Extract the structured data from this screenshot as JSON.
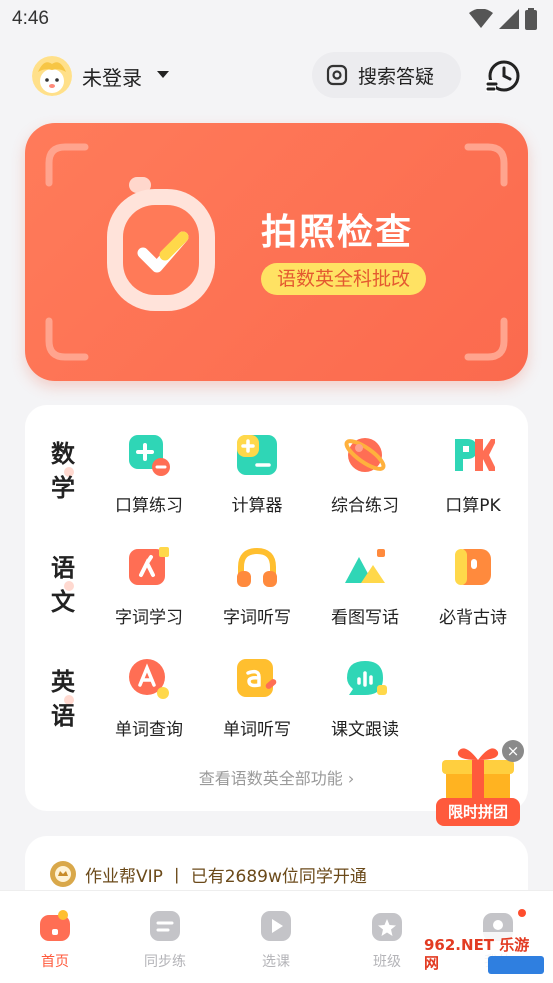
{
  "status_bar": {
    "time": "4:46"
  },
  "header": {
    "user_name": "未登录",
    "search_label": "搜索答疑"
  },
  "hero": {
    "title": "拍照检查",
    "subtitle": "语数英全科批改"
  },
  "subjects": [
    {
      "name": "数学",
      "tools": [
        "口算练习",
        "计算器",
        "综合练习",
        "口算PK"
      ]
    },
    {
      "name": "语文",
      "tools": [
        "字词学习",
        "字词听写",
        "看图写话",
        "必背古诗"
      ]
    },
    {
      "name": "英语",
      "tools": [
        "单词查询",
        "单词听写",
        "课文跟读"
      ]
    }
  ],
  "see_all": "查看语数英全部功能 ›",
  "promo": {
    "label": "限时拼团",
    "close": "×"
  },
  "vip": {
    "text": "作业帮VIP  丨  已有2689w位同学开通"
  },
  "tabs": [
    "首页",
    "同步练",
    "选课",
    "班级",
    "我的"
  ],
  "watermark": "962.NET 乐游网",
  "colors": {
    "accent": "#ff5a3c",
    "hero": "#fb6a4e",
    "badge": "#ffe263",
    "teal": "#2fd6b6",
    "orange": "#ff8a3d",
    "coral": "#ff6e54"
  }
}
